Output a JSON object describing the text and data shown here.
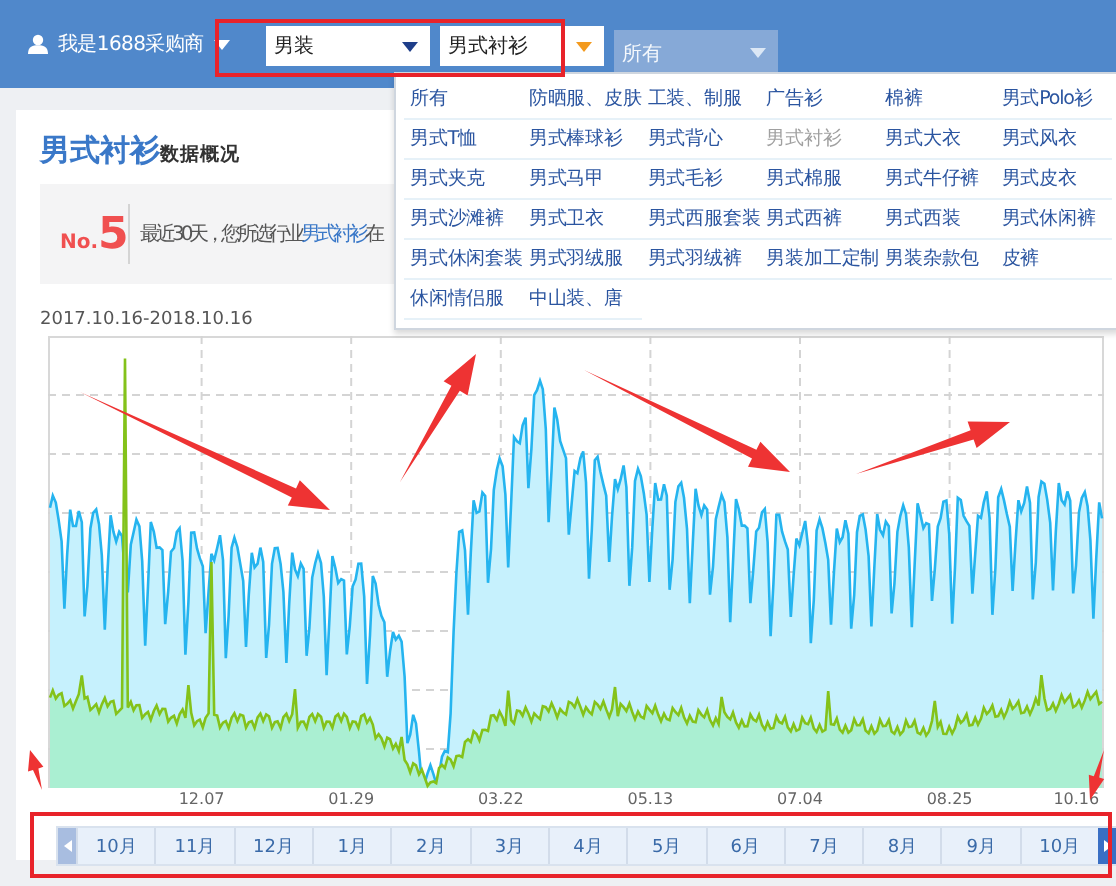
{
  "header": {
    "user": {
      "label": "我是1688采购商"
    },
    "selects": [
      {
        "value": "男装",
        "open": false,
        "disabled": false
      },
      {
        "value": "男式衬衫",
        "open": true,
        "disabled": false
      },
      {
        "value": "所有",
        "open": false,
        "disabled": true
      }
    ]
  },
  "dropdown": {
    "options": [
      {
        "label": "所有",
        "selected": false
      },
      {
        "label": "防晒服、皮肤",
        "selected": false
      },
      {
        "label": "工装、制服",
        "selected": false
      },
      {
        "label": "广告衫",
        "selected": false
      },
      {
        "label": "棉裤",
        "selected": false
      },
      {
        "label": "男式Polo衫",
        "selected": false
      },
      {
        "label": "男式T恤",
        "selected": false
      },
      {
        "label": "男式棒球衫",
        "selected": false
      },
      {
        "label": "男式背心",
        "selected": false
      },
      {
        "label": "男式衬衫",
        "selected": true
      },
      {
        "label": "男式大衣",
        "selected": false
      },
      {
        "label": "男式风衣",
        "selected": false
      },
      {
        "label": "男式夹克",
        "selected": false
      },
      {
        "label": "男式马甲",
        "selected": false
      },
      {
        "label": "男式毛衫",
        "selected": false
      },
      {
        "label": "男式棉服",
        "selected": false
      },
      {
        "label": "男式牛仔裤",
        "selected": false
      },
      {
        "label": "男式皮衣",
        "selected": false
      },
      {
        "label": "男式沙滩裤",
        "selected": false
      },
      {
        "label": "男式卫衣",
        "selected": false
      },
      {
        "label": "男式西服套装",
        "selected": false
      },
      {
        "label": "男式西裤",
        "selected": false
      },
      {
        "label": "男式西装",
        "selected": false
      },
      {
        "label": "男式休闲裤",
        "selected": false
      },
      {
        "label": "男式休闲套装",
        "selected": false
      },
      {
        "label": "男式羽绒服",
        "selected": false
      },
      {
        "label": "男式羽绒裤",
        "selected": false
      },
      {
        "label": "男装加工定制",
        "selected": false
      },
      {
        "label": "男装杂款包",
        "selected": false
      },
      {
        "label": "皮裤",
        "selected": false
      },
      {
        "label": "休闲情侣服",
        "selected": false
      },
      {
        "label": "中山装、唐",
        "selected": false
      }
    ]
  },
  "overview": {
    "title": "男式衬衫",
    "subtitle": "数据概况",
    "rank_prefix": "No.",
    "rank": "5",
    "summary": {
      "before": "最近30天，您所选行业",
      "highlight": "男式衬衫",
      "after": "在"
    }
  },
  "trend": {
    "date_range": "2017.10.16-2018.10.16",
    "x_labels": [
      "12.07",
      "01.29",
      "03.22",
      "05.13",
      "07.04",
      "08.25",
      "10.16"
    ],
    "prev_enabled": false,
    "next_enabled": true,
    "months": [
      "10月",
      "11月",
      "12月",
      "1月",
      "2月",
      "3月",
      "4月",
      "5月",
      "6月",
      "7月",
      "8月",
      "9月",
      "10月"
    ]
  }
}
